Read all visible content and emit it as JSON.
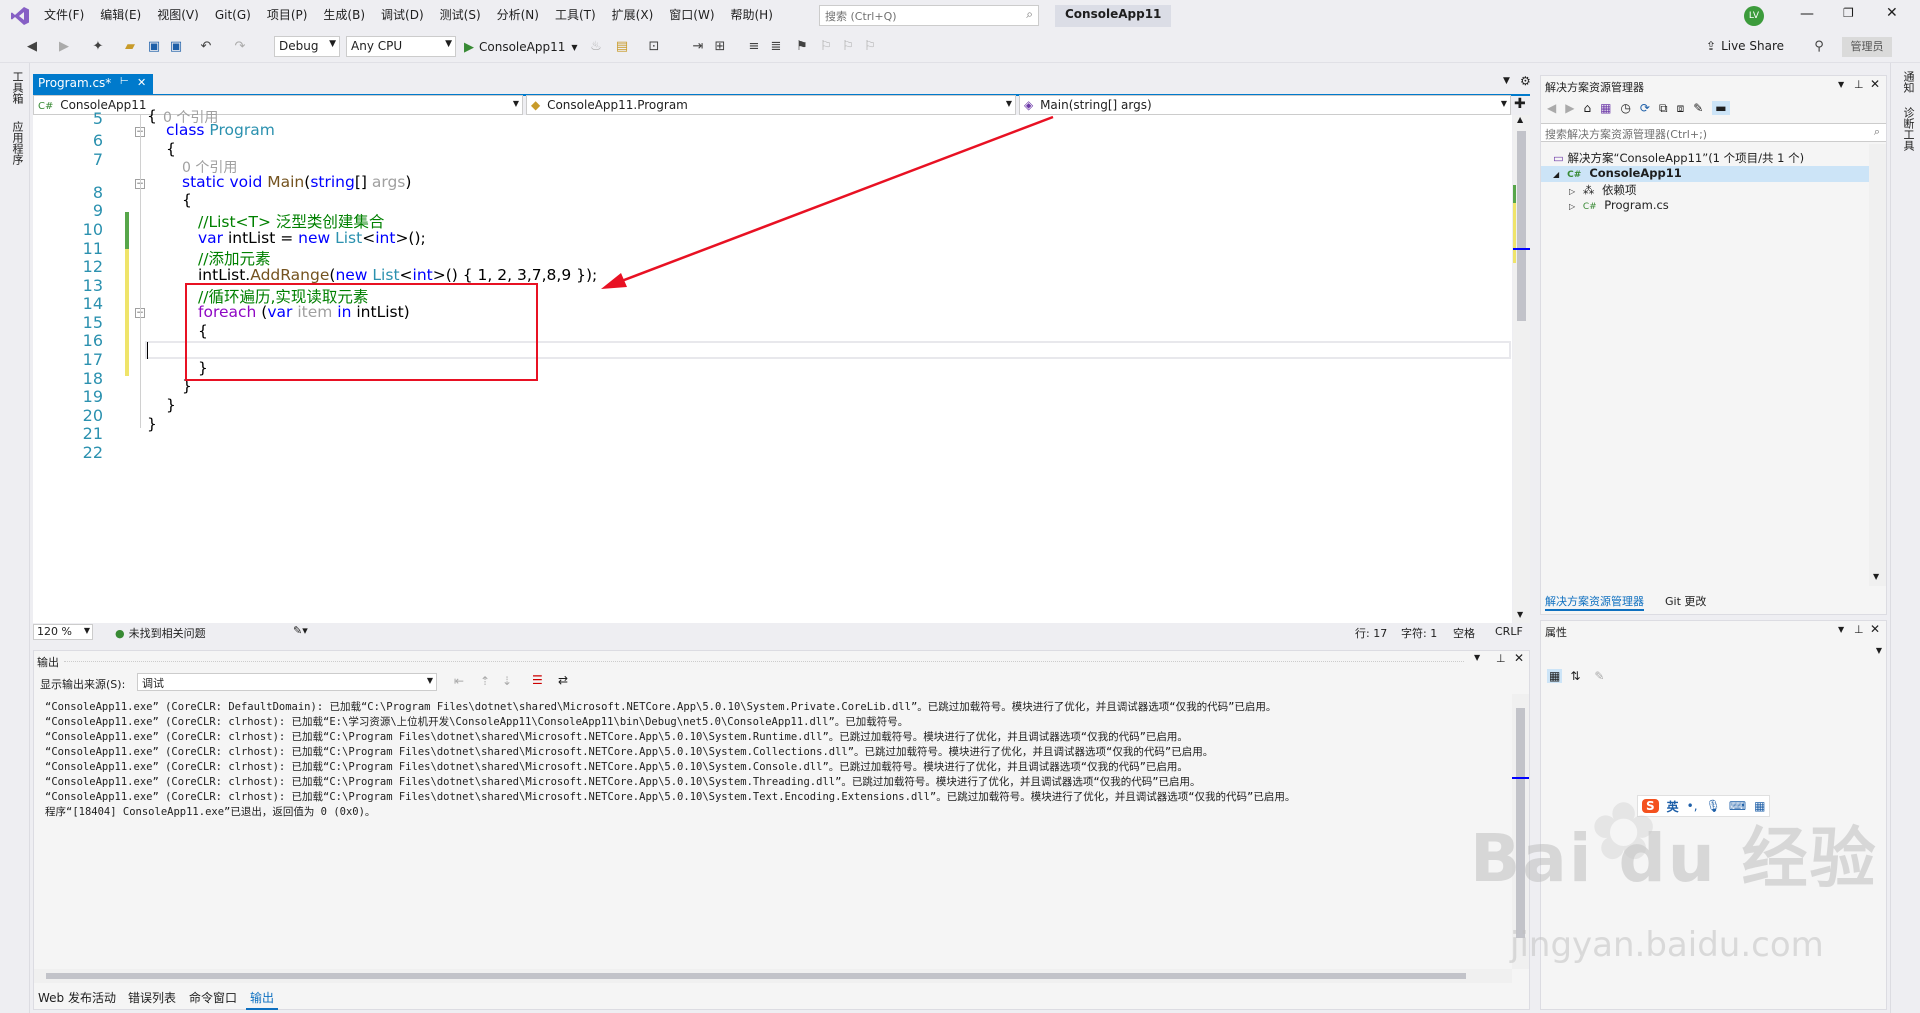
{
  "menu": {
    "items": [
      "文件(F)",
      "编辑(E)",
      "视图(V)",
      "Git(G)",
      "项目(P)",
      "生成(B)",
      "调试(D)",
      "测试(S)",
      "分析(N)",
      "工具(T)",
      "扩展(X)",
      "窗口(W)",
      "帮助(H)"
    ],
    "search_placeholder": "搜索 (Ctrl+Q)",
    "app_title": "ConsoleApp11",
    "avatar_text": "LV"
  },
  "toolbar": {
    "config": "Debug",
    "platform": "Any CPU",
    "run_label": "ConsoleApp11",
    "live_share": "Live Share",
    "admin": "管理员"
  },
  "left_strip": [
    "工具箱",
    "应用程序"
  ],
  "right_strip": [
    "通知",
    "诊断工具"
  ],
  "editor": {
    "tab_label": "Program.cs*",
    "nav_project": "ConsoleApp11",
    "nav_class": "ConsoleApp11.Program",
    "nav_member": "Main(string[] args)",
    "zoom": "120 %",
    "issues": "未找到相关问题",
    "line_info": "行: 17",
    "char_info": "字符: 1",
    "whitespace": "空格",
    "eol": "CRLF",
    "line_numbers": [
      "5",
      "6",
      "7",
      "8",
      "9",
      "10",
      "11",
      "12",
      "13",
      "14",
      "15",
      "16",
      "17",
      "18",
      "19",
      "20",
      "21",
      "22"
    ],
    "ref_label": "0 个引用",
    "code": {
      "l5": "{",
      "l6_kw": "class",
      "l6_name": "Program",
      "l7": "{",
      "l8_kw1": "static",
      "l8_kw2": "void",
      "l8_name": "Main",
      "l8_open": "(",
      "l8_type": "string",
      "l8_rest": "[] ",
      "l8_arg": "args",
      "l8_close": ")",
      "l9": "{",
      "l10": "//List<T> 泛型类创建集合",
      "l11_var": "var",
      "l11_name": " intList = ",
      "l11_new": "new",
      "l11_sp": " ",
      "l11_type": "List",
      "l11_lt": "<",
      "l11_int": "int",
      "l11_end": ">();",
      "l12": "//添加元素",
      "l13_a": "intList.",
      "l13_m": "AddRange",
      "l13_b": "(",
      "l13_new": "new",
      "l13_sp": " ",
      "l13_type": "List",
      "l13_lt": "<",
      "l13_int": "int",
      "l13_c": ">() { 1, 2, 3,7,8,9 });",
      "l14": "//循环遍历,实现读取元素",
      "l15_fe": "foreach",
      "l15_a": " (",
      "l15_var": "var",
      "l15_sp": " ",
      "l15_item": "item",
      "l15_sp2": " ",
      "l15_in": "in",
      "l15_b": " intList)",
      "l16": "{",
      "l18": "}",
      "l19": "}",
      "l20": "}",
      "l21": "}"
    }
  },
  "output": {
    "title": "输出",
    "source_label": "显示输出来源(S):",
    "source_value": "调试",
    "lines": [
      "“ConsoleApp11.exe” (CoreCLR: DefaultDomain): 已加载“C:\\Program Files\\dotnet\\shared\\Microsoft.NETCore.App\\5.0.10\\System.Private.CoreLib.dll”。已跳过加载符号。模块进行了优化，并且调试器选项“仅我的代码”已启用。",
      "“ConsoleApp11.exe” (CoreCLR: clrhost): 已加载“E:\\学习资源\\上位机开发\\ConsoleApp11\\ConsoleApp11\\bin\\Debug\\net5.0\\ConsoleApp11.dll”。已加载符号。",
      "“ConsoleApp11.exe” (CoreCLR: clrhost): 已加载“C:\\Program Files\\dotnet\\shared\\Microsoft.NETCore.App\\5.0.10\\System.Runtime.dll”。已跳过加载符号。模块进行了优化，并且调试器选项“仅我的代码”已启用。",
      "“ConsoleApp11.exe” (CoreCLR: clrhost): 已加载“C:\\Program Files\\dotnet\\shared\\Microsoft.NETCore.App\\5.0.10\\System.Collections.dll”。已跳过加载符号。模块进行了优化，并且调试器选项“仅我的代码”已启用。",
      "“ConsoleApp11.exe” (CoreCLR: clrhost): 已加载“C:\\Program Files\\dotnet\\shared\\Microsoft.NETCore.App\\5.0.10\\System.Console.dll”。已跳过加载符号。模块进行了优化，并且调试器选项“仅我的代码”已启用。",
      "“ConsoleApp11.exe” (CoreCLR: clrhost): 已加载“C:\\Program Files\\dotnet\\shared\\Microsoft.NETCore.App\\5.0.10\\System.Threading.dll”。已跳过加载符号。模块进行了优化，并且调试器选项“仅我的代码”已启用。",
      "“ConsoleApp11.exe” (CoreCLR: clrhost): 已加载“C:\\Program Files\\dotnet\\shared\\Microsoft.NETCore.App\\5.0.10\\System.Text.Encoding.Extensions.dll”。已跳过加载符号。模块进行了优化，并且调试器选项“仅我的代码”已启用。",
      "程序“[18404] ConsoleApp11.exe”已退出，返回值为 0 (0x0)。"
    ]
  },
  "bottom_tabs": [
    "Web 发布活动",
    "错误列表",
    "命令窗口",
    "输出"
  ],
  "solution": {
    "title": "解决方案资源管理器",
    "search_placeholder": "搜索解决方案资源管理器(Ctrl+;)",
    "solution_label": "解决方案“ConsoleApp11”(1 个项目/共 1 个)",
    "project": "ConsoleApp11",
    "deps": "依赖项",
    "file": "Program.cs",
    "tab_solution": "解决方案资源管理器",
    "tab_git": "Git 更改"
  },
  "properties": {
    "title": "属性"
  },
  "ime": {
    "lang": "英"
  },
  "watermark": {
    "brand": "Bai du 经验",
    "url": "jingyan.baidu.com"
  },
  "colors": {
    "accent": "#007acc",
    "highlight_box": "#e81123",
    "arrow": "#e81123"
  }
}
